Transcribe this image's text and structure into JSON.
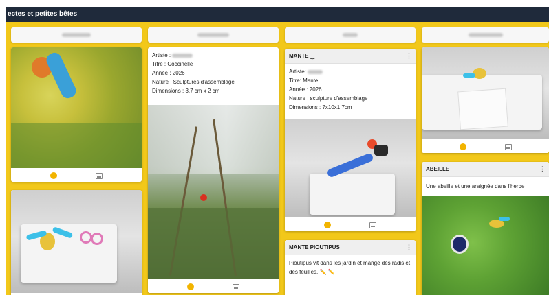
{
  "board_title": "ectes et petites bêtes",
  "columns": [
    {
      "cards": [
        {
          "footer": true
        },
        {
          "footer": true
        }
      ]
    },
    {
      "cards": [
        {
          "lines": [
            "Artiste : ",
            "Titre : Coccinelle",
            "Année : 2026",
            "Nature : Sculptures d'assemblage",
            "Dimensions : 3,7 cm x 2 cm"
          ],
          "footer": true
        }
      ]
    },
    {
      "cards": [
        {
          "title": "MANTE",
          "title_icon": "smile-icon",
          "lines": [
            "Artiste: ",
            "Titre: Mante",
            "Année : 2026",
            "Nature : sculpture d'assemblage",
            "Dimensions : 7x10x1,7cm"
          ],
          "footer": true
        },
        {
          "title": "MANTE PIOUTIPUS",
          "text": "Pioutipus vit dans les jardin et mange des radis et des feuilles. ✏️ ✏️"
        }
      ]
    },
    {
      "cards": [
        {
          "footer": true
        },
        {
          "title": "ABEILLE",
          "text": "Une abeille et une araignée dans l'herbe"
        }
      ]
    }
  ],
  "colors": {
    "board_bg": "#f2c81a",
    "topbar_bg": "#1f2a3b",
    "accent_dot": "#f2b400"
  },
  "icons": [
    "more-icon",
    "reaction-dot-icon",
    "image-icon",
    "smile-icon"
  ]
}
